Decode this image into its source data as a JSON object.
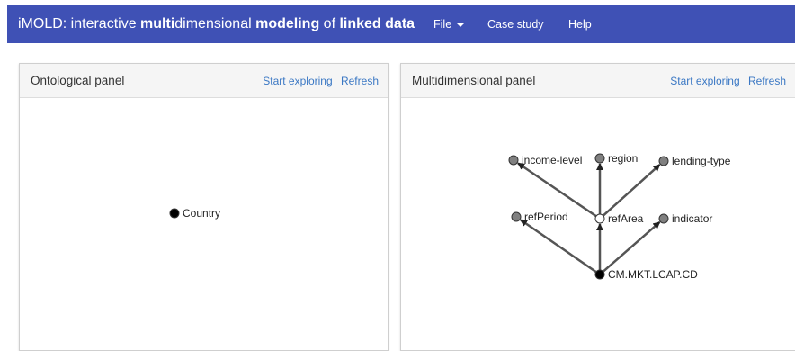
{
  "navbar": {
    "title_parts": [
      {
        "text": "iMOLD: ",
        "bold": false
      },
      {
        "text": "interactive",
        "bold": false
      },
      {
        "text": " ",
        "bold": false
      },
      {
        "text": "multi",
        "bold": true
      },
      {
        "text": "dimensional",
        "bold": false
      },
      {
        "text": " ",
        "bold": false
      },
      {
        "text": "modeling",
        "bold": true
      },
      {
        "text": " of ",
        "bold": false
      },
      {
        "text": "linked",
        "bold": true
      },
      {
        "text": " ",
        "bold": false
      },
      {
        "text": "data",
        "bold": true
      }
    ],
    "file_label": "File",
    "case_study_label": "Case study",
    "help_label": "Help",
    "background": "#3f51b5"
  },
  "ontological_panel": {
    "title": "Ontological panel",
    "start_label": "Start exploring",
    "refresh_label": "Refresh",
    "nodes": [
      {
        "id": "country",
        "label": "Country",
        "fill": "#000000"
      }
    ],
    "edges": []
  },
  "multidimensional_panel": {
    "title": "Multidimensional panel",
    "start_label": "Start exploring",
    "refresh_label": "Refresh",
    "nodes": [
      {
        "id": "income-level",
        "label": "income-level",
        "fill": "#808080"
      },
      {
        "id": "region",
        "label": "region",
        "fill": "#808080"
      },
      {
        "id": "lending-type",
        "label": "lending-type",
        "fill": "#808080"
      },
      {
        "id": "refPeriod",
        "label": "refPeriod",
        "fill": "#808080"
      },
      {
        "id": "refArea",
        "label": "refArea",
        "fill": "#ffffff"
      },
      {
        "id": "indicator",
        "label": "indicator",
        "fill": "#808080"
      },
      {
        "id": "cm-mkt-lcap-cd",
        "label": "CM.MKT.LCAP.CD",
        "fill": "#000000"
      }
    ],
    "edges": [
      {
        "from": "cm-mkt-lcap-cd",
        "to": "refPeriod"
      },
      {
        "from": "cm-mkt-lcap-cd",
        "to": "refArea"
      },
      {
        "from": "cm-mkt-lcap-cd",
        "to": "indicator"
      },
      {
        "from": "refArea",
        "to": "income-level"
      },
      {
        "from": "refArea",
        "to": "region"
      },
      {
        "from": "refArea",
        "to": "lending-type"
      }
    ]
  },
  "colors": {
    "link": "#3b78c4",
    "edge": "#555555"
  }
}
